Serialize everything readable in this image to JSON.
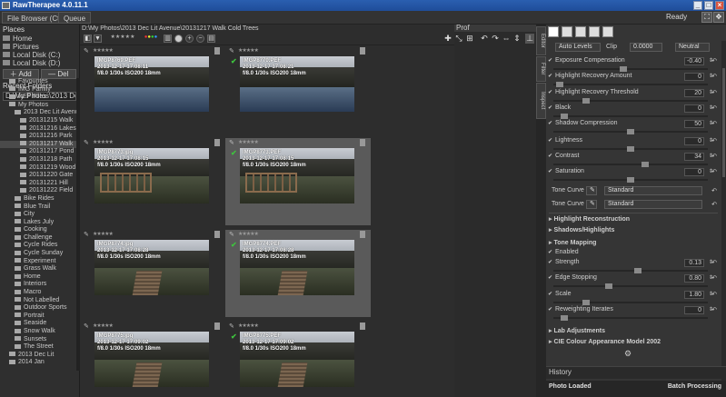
{
  "window": {
    "title": "RawTherapee 4.0.11.1"
  },
  "topbar": {
    "file_browser_tab": "File Browser (Ctrl+F)",
    "queue_tab": "Queue",
    "status": "Ready"
  },
  "left": {
    "places_header": "Places",
    "places": [
      "Home",
      "Pictures",
      "Local Disk (C:)",
      "Local Disk (D:)"
    ],
    "add_label": "Add",
    "del_label": "Del",
    "recent_header": "Recent Folders",
    "recent_value": "D:\\My Photos\\2013 Dec Lit Avenue\\2",
    "tree": [
      {
        "label": "Favourites",
        "depth": 1,
        "sel": false
      },
      {
        "label": "IMG Family",
        "depth": 1,
        "sel": false
      },
      {
        "label": "NEF Files",
        "depth": 1,
        "sel": false
      },
      {
        "label": "My Photos",
        "depth": 1,
        "sel": false
      },
      {
        "label": "2013 Dec Lit Avenue",
        "depth": 2,
        "sel": false
      },
      {
        "label": "20131215 Walk",
        "depth": 3,
        "sel": false
      },
      {
        "label": "20131216 Lakes",
        "depth": 3,
        "sel": false
      },
      {
        "label": "20131216 Park",
        "depth": 3,
        "sel": false
      },
      {
        "label": "20131217 Walk",
        "depth": 3,
        "sel": true
      },
      {
        "label": "20131217 Pond",
        "depth": 3,
        "sel": false
      },
      {
        "label": "20131218 Path",
        "depth": 3,
        "sel": false
      },
      {
        "label": "20131219 Wood",
        "depth": 3,
        "sel": false
      },
      {
        "label": "20131220 Gate",
        "depth": 3,
        "sel": false
      },
      {
        "label": "20131221 Hill",
        "depth": 3,
        "sel": false
      },
      {
        "label": "20131222 Field",
        "depth": 3,
        "sel": false
      },
      {
        "label": "Bike Rides",
        "depth": 2,
        "sel": false
      },
      {
        "label": "Blue Trail",
        "depth": 2,
        "sel": false
      },
      {
        "label": "City",
        "depth": 2,
        "sel": false
      },
      {
        "label": "Lakes July",
        "depth": 2,
        "sel": false
      },
      {
        "label": "Cooking",
        "depth": 2,
        "sel": false
      },
      {
        "label": "Challenge",
        "depth": 2,
        "sel": false
      },
      {
        "label": "Cycle Rides",
        "depth": 2,
        "sel": false
      },
      {
        "label": "Cycle Sunday",
        "depth": 2,
        "sel": false
      },
      {
        "label": "Experiment",
        "depth": 2,
        "sel": false
      },
      {
        "label": "Grass Walk",
        "depth": 2,
        "sel": false
      },
      {
        "label": "Home",
        "depth": 2,
        "sel": false
      },
      {
        "label": "Interiors",
        "depth": 2,
        "sel": false
      },
      {
        "label": "Macro",
        "depth": 2,
        "sel": false
      },
      {
        "label": "Not Labelled",
        "depth": 2,
        "sel": false
      },
      {
        "label": "Outdoor Sports",
        "depth": 2,
        "sel": false
      },
      {
        "label": "Portrait",
        "depth": 2,
        "sel": false
      },
      {
        "label": "Seaside",
        "depth": 2,
        "sel": false
      },
      {
        "label": "Snow Walk",
        "depth": 2,
        "sel": false
      },
      {
        "label": "Sunsets",
        "depth": 2,
        "sel": false
      },
      {
        "label": "The Street",
        "depth": 2,
        "sel": false
      },
      {
        "label": "2013 Dec Lit",
        "depth": 1,
        "sel": false
      },
      {
        "label": "2014 Jan",
        "depth": 1,
        "sel": false
      }
    ]
  },
  "center": {
    "path": "D:\\My Photos\\2013 Dec Lit Avenue\\20131217 Walk Cold Trees",
    "thumbs": [
      {
        "name": "IMGP8769.PEF",
        "date": "2013-12-17 17:08:11",
        "exif": "f/8.0 1/30s ISO200 18mm",
        "scene": "water",
        "sel": false,
        "edited": false
      },
      {
        "name": "IMGP8770.PEF",
        "date": "2013-12-17 17:08:21",
        "exif": "f/8.0 1/30s ISO200 18mm",
        "scene": "water",
        "sel": false,
        "edited": true
      },
      {
        "name": "IMGP8773.jpg",
        "date": "2013-12-17 17:08:15",
        "exif": "f/8.0 1/30s ISO200 18mm",
        "scene": "gate",
        "sel": false,
        "edited": false
      },
      {
        "name": "IMGP8773.PEF",
        "date": "2013-12-17 17:08:15",
        "exif": "f/8.0 1/30s ISO200 18mm",
        "scene": "gate",
        "sel": true,
        "edited": true
      },
      {
        "name": "IMGP8774.jpg",
        "date": "2013-12-17 17:08:28",
        "exif": "f/8.0 1/30s ISO200 18mm",
        "scene": "bridge",
        "sel": false,
        "edited": false
      },
      {
        "name": "IMGP8774.PEF",
        "date": "2013-12-17 17:08:28",
        "exif": "f/8.0 1/30s ISO200 18mm",
        "scene": "bridge",
        "sel": true,
        "edited": true
      },
      {
        "name": "IMGP8775.jpg",
        "date": "2013-12-17 17:09:02",
        "exif": "f/8.0 1/30s ISO200 18mm",
        "scene": "path",
        "sel": false,
        "edited": false
      },
      {
        "name": "IMGP8775.PEF",
        "date": "2013-12-17 17:09:02",
        "exif": "f/8.0 1/30s ISO200 18mm",
        "scene": "path",
        "sel": false,
        "edited": true
      }
    ],
    "stars": "★★★★★"
  },
  "right_panel": {
    "editor_tab": "Prof"
  },
  "vtabs": [
    "Editor",
    "Filter",
    "Inspect"
  ],
  "tools": {
    "auto_levels": "Auto Levels",
    "clip_label": "Clip",
    "clip_value": "0.0000",
    "neutral": "Neutral",
    "sliders": [
      {
        "label": "Exposure Compensation",
        "value": "-0.40",
        "knob": 0.45
      },
      {
        "label": "Highlight Recovery Amount",
        "value": "0",
        "knob": 0.02
      },
      {
        "label": "Highlight Recovery Threshold",
        "value": "20",
        "knob": 0.2
      },
      {
        "label": "Black",
        "value": "0",
        "knob": 0.05
      },
      {
        "label": "Shadow Compression",
        "value": "50",
        "knob": 0.5
      },
      {
        "label": "Lightness",
        "value": "0",
        "knob": 0.5
      },
      {
        "label": "Contrast",
        "value": "34",
        "knob": 0.6
      },
      {
        "label": "Saturation",
        "value": "0",
        "knob": 0.5
      }
    ],
    "tone_curve_1": "Tone Curve 1",
    "tone_curve_2": "Tone Curve 2",
    "curve_mode": "Standard",
    "sections": [
      "Highlight Reconstruction",
      "Shadows/Highlights",
      "Tone Mapping"
    ],
    "enabled": "Enabled",
    "tm_sliders": [
      {
        "label": "Strength",
        "value": "0.13",
        "knob": 0.55
      },
      {
        "label": "Edge Stopping",
        "value": "0.80",
        "knob": 0.35
      },
      {
        "label": "Scale",
        "value": "1.80",
        "knob": 0.2
      },
      {
        "label": "Reweighting Iterates",
        "value": "0",
        "knob": 0.05
      }
    ],
    "lab": "Lab Adjustments",
    "ciecam": "CIE Colour Appearance Model 2002",
    "history": "History",
    "status_left": "Photo Loaded",
    "status_right": "Batch Processing"
  }
}
